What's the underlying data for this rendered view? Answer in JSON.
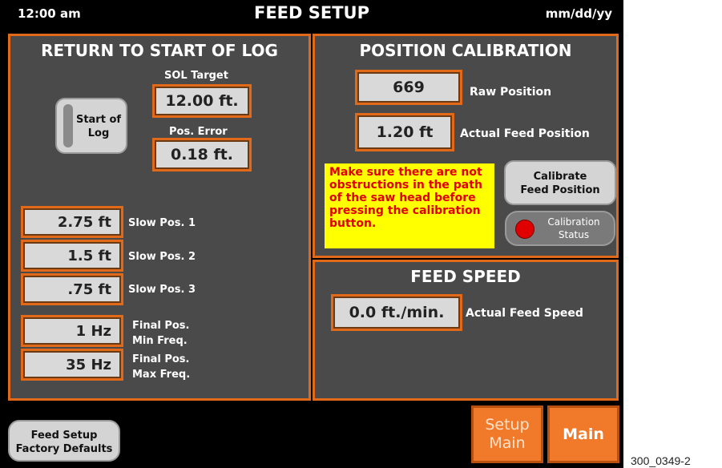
{
  "header": {
    "time": "12:00 am",
    "title": "FEED SETUP",
    "date": "mm/dd/yy"
  },
  "return_to_start": {
    "title": "RETURN TO START OF LOG",
    "start_of_log_button": "Start of\nLog",
    "sol_target_label": "SOL Target",
    "sol_target_value": "12.00 ft.",
    "pos_error_label": "Pos. Error",
    "pos_error_value": "0.18 ft.",
    "slow_positions": [
      {
        "value": "2.75 ft",
        "label": "Slow Pos. 1"
      },
      {
        "value": "1.5 ft",
        "label": "Slow Pos. 2"
      },
      {
        "value": ".75 ft",
        "label": "Slow Pos. 3"
      }
    ],
    "final_min": {
      "value": "1 Hz",
      "label_line1": "Final Pos.",
      "label_line2": "Min Freq."
    },
    "final_max": {
      "value": "35 Hz",
      "label_line1": "Final Pos.",
      "label_line2": "Max Freq."
    }
  },
  "position_calibration": {
    "title": "POSITION CALIBRATION",
    "raw_value": "669",
    "raw_label": "Raw Position",
    "actual_value": "1.20 ft",
    "actual_label": "Actual Feed Position",
    "warning": "Make sure there are not obstructions in the path of the saw head before pressing the calibration button.",
    "calibrate_button": "Calibrate\nFeed Position",
    "status_label": "Calibration\nStatus",
    "status_color": "#e00000"
  },
  "feed_speed": {
    "title": "FEED SPEED",
    "value": "0.0 ft./min.",
    "label": "Actual Feed Speed"
  },
  "footer": {
    "factory_defaults_button": "Feed Setup\nFactory Defaults",
    "setup_main_button": "Setup\nMain",
    "main_button": "Main"
  },
  "caption": "300_0349-2",
  "colors": {
    "accent": "#e06a1a",
    "panel": "#4a4a4a",
    "warning_bg": "#ffff00",
    "warning_text": "#e00000"
  }
}
